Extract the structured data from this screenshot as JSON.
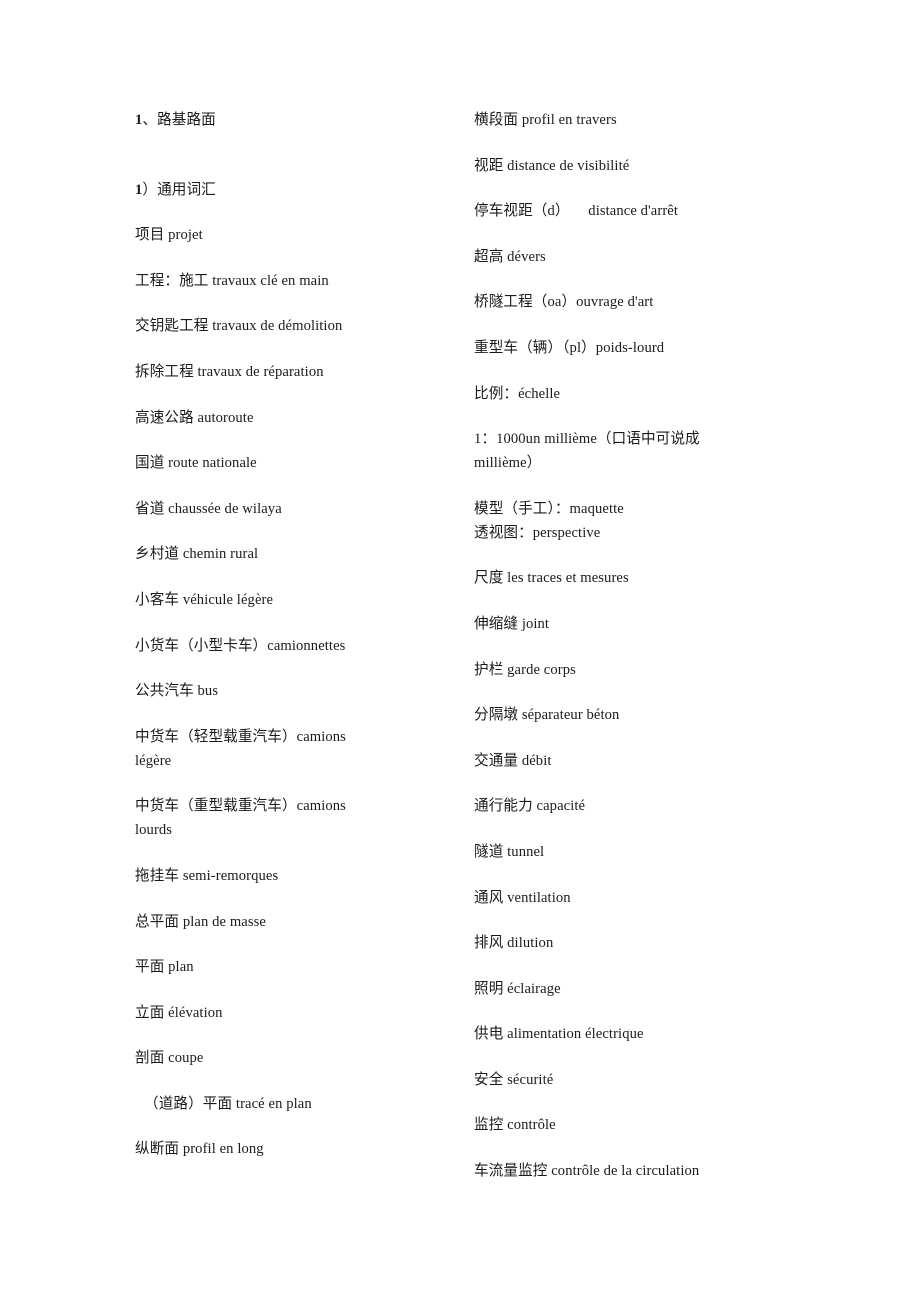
{
  "document": {
    "title": "1、路基路面",
    "section_heading": "1）通用词汇",
    "background_color": "#ffffff",
    "text_color": "#1b1b1b"
  },
  "left_column": {
    "heading": "1、路基路面",
    "subheading": "1）通用词汇",
    "entries": [
      "项目 projet",
      "工程：施工 travaux clé en main",
      "交钥匙工程 travaux de démolition",
      "拆除工程 travaux de réparation",
      "高速公路 autoroute",
      "国道 route nationale",
      "省道 chaussée de wilaya",
      "乡村道 chemin rural",
      "小客车 véhicule légère",
      "小货车（小型卡车）camionnettes",
      "公共汽车 bus",
      "中货车（轻型载重汽车）camions légère",
      "中货车（重型载重汽车）camions lourds",
      "拖挂车 semi-remorques",
      "总平面 plan de masse",
      "平面 plan",
      "立面 élévation",
      "剖面 coupe",
      "（道路）平面 tracé en plan",
      "纵断面 profil en long"
    ]
  },
  "right_column": {
    "entries": [
      "横段面 profil en travers",
      "视距 distance de visibilité",
      "停车视距（d）     distance d'arrêt",
      "超高 dévers",
      "桥隧工程（oa）ouvrage d'art",
      "重型车（辆）（pl）poids-lourd",
      "比例：échelle",
      "1：1000un millième（口语中可说成 millième）",
      "模型（手工）：maquette",
      "透视图：perspective",
      "尺度 les traces et mesures",
      "伸缩缝 joint",
      "护栏 garde corps",
      "分隔墩 séparateur béton",
      "交通量 débit",
      "通行能力 capacité",
      "隧道 tunnel",
      "通风 ventilation",
      "排风 dilution",
      "照明 éclairage",
      "供电 alimentation électrique",
      "安全 sécurité",
      "监控 contrôle",
      "车流量监控 contrôle de la circulation"
    ]
  }
}
